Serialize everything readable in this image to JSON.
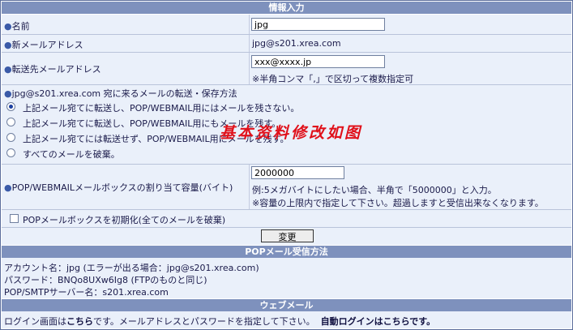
{
  "header1": "情報入力",
  "name_row": {
    "label": "名前",
    "value": "jpg"
  },
  "newmail_row": {
    "label": "新メールアドレス",
    "value": "jpg@s201.xrea.com"
  },
  "forward_row": {
    "label": "転送先メールアドレス",
    "value": "xxx@xxxx.jp",
    "note": "※半角コンマ「,」で区切って複数指定可"
  },
  "method": {
    "title": "jpg@s201.xrea.com 宛に来るメールの転送・保存方法",
    "options": [
      "上記メール宛てに転送し、POP/WEBMAIL用にはメールを残さない。",
      "上記メール宛てに転送し、POP/WEBMAIL用にもメールを残す。",
      "上記メール宛てには転送せず、POP/WEBMAIL用にメールを残す。",
      "すべてのメールを破棄。"
    ],
    "selected_index": 0
  },
  "watermark": "基本资料修改如图",
  "quota": {
    "label": "POP/WEBMAILメールボックスの割り当て容量(バイト)",
    "value": "2000000",
    "note1": "例:5メガバイトにしたい場合、半角で「5000000」と入力。",
    "note2": "※容量の上限内で指定して下さい。超過しますと受信出来なくなります。"
  },
  "init_checkbox": "POPメールボックスを初期化(全てのメールを破棄)",
  "submit": "変更",
  "header2": "POPメール受信方法",
  "pop": {
    "account": "アカウント名：jpg (エラーが出る場合：jpg@s201.xrea.com)",
    "password": "パスワード：BNQo8UXw6Ig8 (FTPのものと同じ)",
    "server": "POP/SMTPサーバー名：s201.xrea.com"
  },
  "header3": "ウェブメール",
  "webmail": {
    "text1": "ログイン画面は",
    "link1": "こちら",
    "text2": "です。メールアドレスとパスワードを指定して下さい。",
    "text3": "自動ログインは",
    "link2": "こちら",
    "text4": "です。"
  },
  "colors": {
    "header_bg": "#7e91bd",
    "row_bg": "#eaf0fa",
    "text": "#1a1a4a",
    "watermark": "#e0101a"
  }
}
